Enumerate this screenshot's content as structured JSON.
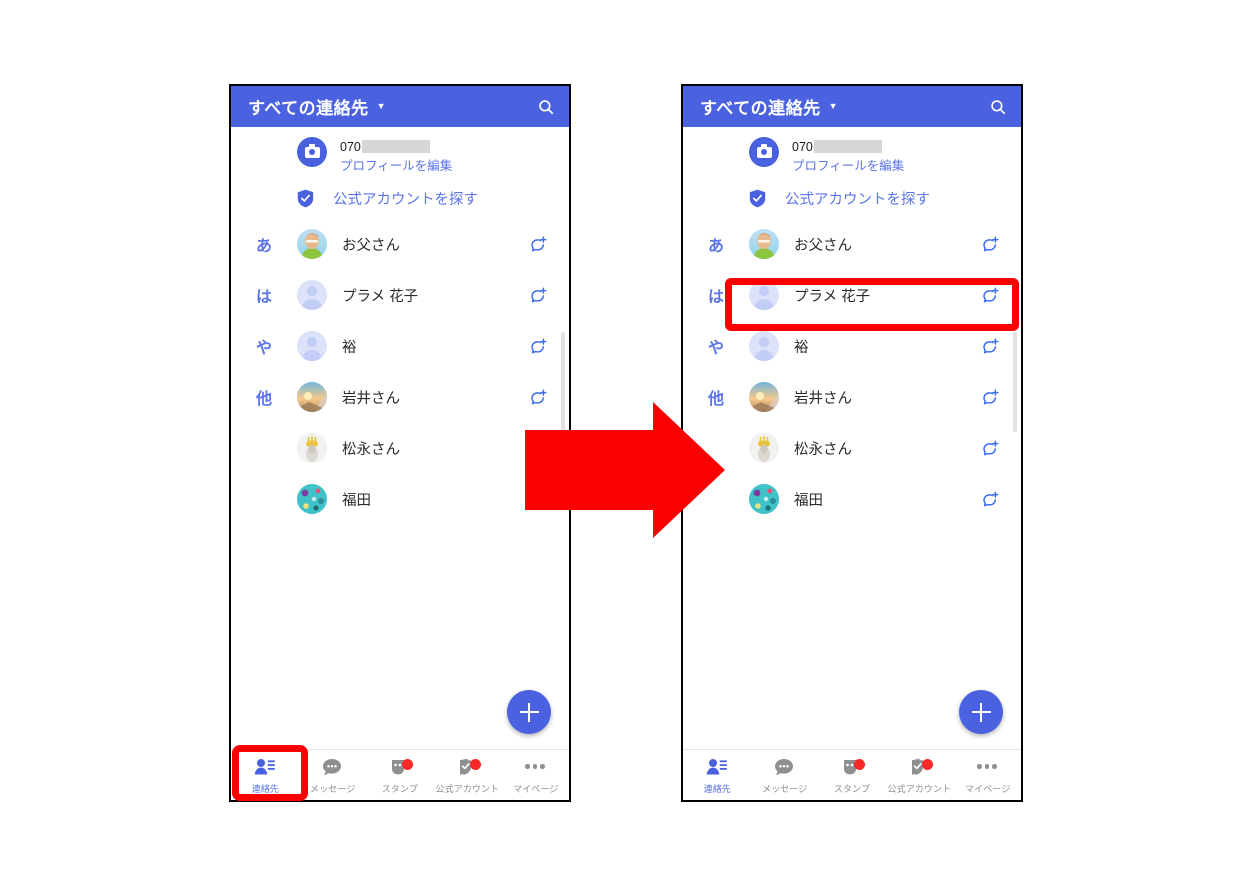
{
  "app": {
    "header": {
      "title": "すべての連絡先",
      "caret_icon": "chevron-down-icon",
      "search_icon": "search-icon"
    },
    "profile": {
      "avatar_icon": "camera-icon",
      "phone_prefix": "070",
      "redacted": "",
      "edit_label": "プロフィールを編集"
    },
    "official": {
      "shield_icon": "shield-check-icon",
      "label": "公式アカウントを探す"
    },
    "contacts": [
      {
        "kana": "あ",
        "name": "お父さん",
        "avatar": "photo-person",
        "action_icon": "add-friend-icon"
      },
      {
        "kana": "は",
        "name": "プラメ 花子",
        "avatar": "placeholder",
        "action_icon": "add-friend-icon"
      },
      {
        "kana": "や",
        "name": "裕",
        "avatar": "placeholder",
        "action_icon": "add-friend-icon"
      },
      {
        "kana": "他",
        "name": "岩井さん",
        "avatar": "photo-sunset",
        "action_icon": "add-friend-icon"
      },
      {
        "kana": "",
        "name": "松永さん",
        "avatar": "photo-statue",
        "action_icon": "add-friend-icon"
      },
      {
        "kana": "",
        "name": "福田",
        "avatar": "photo-teal",
        "action_icon": "add-friend-icon"
      }
    ],
    "fab": {
      "icon": "plus-icon",
      "label": "+"
    },
    "bottom_nav": [
      {
        "label": "連絡先",
        "icon": "contacts-icon",
        "active": true,
        "badge": false
      },
      {
        "label": "メッセージ",
        "icon": "chat-bubble-icon",
        "active": false,
        "badge": false
      },
      {
        "label": "スタンプ",
        "icon": "sticker-icon",
        "active": false,
        "badge": true
      },
      {
        "label": "公式アカウント",
        "icon": "official-check-icon",
        "active": false,
        "badge": true
      },
      {
        "label": "マイページ",
        "icon": "more-dots-icon",
        "active": false,
        "badge": false
      }
    ]
  },
  "annotations": {
    "arrow": {
      "icon": "right-arrow",
      "color": "#fb0000"
    },
    "highlight_nav": {
      "color": "#fb0000",
      "target": "連絡先"
    },
    "highlight_contact": {
      "color": "#fb0000",
      "target": "プラメ 花子"
    }
  },
  "colors": {
    "header_blue": "#4a62e0",
    "accent_blue": "#5b75e8",
    "annotation_red": "#fb0000",
    "badge_red": "#fa2828"
  }
}
